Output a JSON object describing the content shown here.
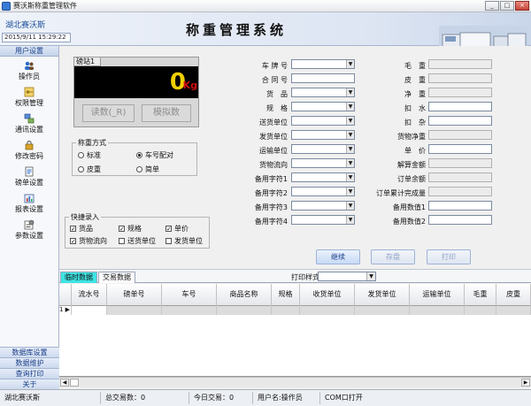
{
  "window": {
    "title": "赛沃斯称重管理软件",
    "minimize": "_",
    "maximize": "□",
    "close": "×"
  },
  "header": {
    "company": "湖北赛沃斯",
    "datetime": "2015/9/11  15:29:22",
    "app_title": "称重管理系统"
  },
  "sidebar": {
    "title": "用户设置",
    "items": [
      {
        "label": "操作员",
        "icon": "users-icon"
      },
      {
        "label": "权限管理",
        "icon": "key-icon"
      },
      {
        "label": "通讯设置",
        "icon": "network-icon"
      },
      {
        "label": "修改密码",
        "icon": "lock-icon"
      },
      {
        "label": "磅单设置",
        "icon": "document-icon"
      },
      {
        "label": "报表设置",
        "icon": "report-icon"
      },
      {
        "label": "参数设置",
        "icon": "settings-icon"
      }
    ],
    "bottom_links": [
      "数据库设置",
      "数据维护",
      "查询打印",
      "关于"
    ]
  },
  "scale": {
    "tab": "磅站1",
    "weight": "0",
    "unit": "Kg",
    "read_button": "读数(_R)",
    "simulate_button": "模拟数"
  },
  "weigh_mode": {
    "title": "称重方式",
    "options": [
      "标准",
      "车号配对",
      "皮重",
      "简单"
    ],
    "selected": "车号配对"
  },
  "quick_entry": {
    "title": "快捷录入",
    "options": [
      {
        "label": "货品",
        "checked": true
      },
      {
        "label": "规格",
        "checked": true
      },
      {
        "label": "单价",
        "checked": true
      },
      {
        "label": "货物流向",
        "checked": true
      },
      {
        "label": "送货单位",
        "checked": false
      },
      {
        "label": "发货单位",
        "checked": false
      }
    ]
  },
  "form_left": [
    {
      "label": "车 牌 号",
      "type": "combo",
      "value": ""
    },
    {
      "label": "合 同 号",
      "type": "text",
      "value": ""
    },
    {
      "label": "货　品",
      "type": "combo",
      "value": ""
    },
    {
      "label": "规　格",
      "type": "combo",
      "value": ""
    },
    {
      "label": "送货单位",
      "type": "combo",
      "value": ""
    },
    {
      "label": "发货单位",
      "type": "combo",
      "value": ""
    },
    {
      "label": "运输单位",
      "type": "combo",
      "value": ""
    },
    {
      "label": "货物流向",
      "type": "combo",
      "value": ""
    },
    {
      "label": "备用字符1",
      "type": "combo",
      "value": ""
    },
    {
      "label": "备用字符2",
      "type": "combo",
      "value": ""
    },
    {
      "label": "备用字符3",
      "type": "combo",
      "value": ""
    },
    {
      "label": "备用字符4",
      "type": "combo",
      "value": ""
    }
  ],
  "form_right": [
    {
      "label": "毛　重",
      "type": "readonly",
      "value": ""
    },
    {
      "label": "皮　重",
      "type": "readonly",
      "value": ""
    },
    {
      "label": "净　重",
      "type": "readonly",
      "value": ""
    },
    {
      "label": "扣　水",
      "type": "text",
      "value": ""
    },
    {
      "label": "扣　杂",
      "type": "text",
      "value": ""
    },
    {
      "label": "货物净重",
      "type": "readonly",
      "value": ""
    },
    {
      "label": "单　价",
      "type": "text",
      "value": ""
    },
    {
      "label": "解算金额",
      "type": "readonly",
      "value": ""
    },
    {
      "label": "订单余额",
      "type": "readonly",
      "value": ""
    },
    {
      "label": "订单累计完成量",
      "type": "readonly",
      "value": ""
    },
    {
      "label": "备用数值1",
      "type": "text",
      "value": ""
    },
    {
      "label": "备用数值2",
      "type": "text",
      "value": ""
    }
  ],
  "actions": {
    "continue": "继续",
    "save": "存盘",
    "print": "打印"
  },
  "tabs": [
    {
      "label": "临时数据",
      "active": true
    },
    {
      "label": "交易数据",
      "active": false
    }
  ],
  "print_style": {
    "label": "打印样式",
    "value": ""
  },
  "grid": {
    "columns": [
      "",
      "流水号",
      "磅单号",
      "车号",
      "商品名称",
      "规格",
      "收货单位",
      "发货单位",
      "运输单位",
      "毛重",
      "皮重"
    ],
    "row_indicator": "1 ▶"
  },
  "status": {
    "company": "湖北赛沃斯",
    "total": "总交易数：0",
    "today": "今日交易：0",
    "user": "用户名:操作员",
    "port": "COM口打开"
  }
}
